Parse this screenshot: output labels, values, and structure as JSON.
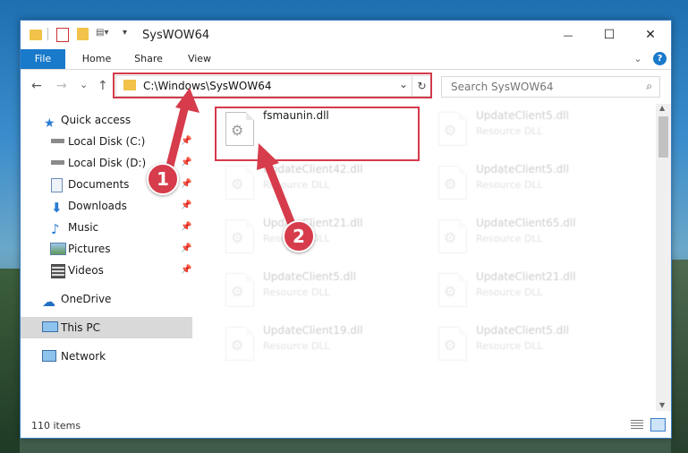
{
  "window": {
    "title": "SysWOW64",
    "minimize": "—",
    "maximize": "☐",
    "close": "✕"
  },
  "ribbon": {
    "tabs": [
      "File",
      "Home",
      "Share",
      "View"
    ],
    "expand": "⌄",
    "help": "?"
  },
  "nav": {
    "back": "←",
    "forward": "→",
    "recent": "⌄",
    "up": "↑"
  },
  "address": {
    "path": "C:\\Windows\\SysWOW64",
    "dropdown": "⌄",
    "refresh": "↻"
  },
  "search": {
    "placeholder": "Search SysWOW64",
    "icon": "search-icon"
  },
  "sidebar": {
    "items": [
      {
        "label": "Quick access",
        "icon": "star-icon"
      },
      {
        "label": "Local Disk (C:)",
        "icon": "drive-icon",
        "pinned": true
      },
      {
        "label": "Local Disk (D:)",
        "icon": "drive-icon",
        "pinned": true
      },
      {
        "label": "Documents",
        "icon": "documents-icon",
        "pinned": true
      },
      {
        "label": "Downloads",
        "icon": "download-icon",
        "pinned": true
      },
      {
        "label": "Music",
        "icon": "music-icon",
        "pinned": true
      },
      {
        "label": "Pictures",
        "icon": "pictures-icon",
        "pinned": true
      },
      {
        "label": "Videos",
        "icon": "videos-icon",
        "pinned": true
      },
      {
        "label": "OneDrive",
        "icon": "cloud-icon"
      },
      {
        "label": "This PC",
        "icon": "computer-icon",
        "selected": true
      },
      {
        "label": "Network",
        "icon": "network-icon"
      }
    ]
  },
  "files": [
    {
      "name": "fsmaunin.dll",
      "type": "",
      "highlight": true
    },
    {
      "name": "UpdateClient5.dll",
      "type": "Resource DLL"
    },
    {
      "name": "UpdateClient42.dll",
      "type": "Resource DLL"
    },
    {
      "name": "UpdateClient5.dll",
      "type": "Resource DLL"
    },
    {
      "name": "UpdateClient21.dll",
      "type": "Resource DLL"
    },
    {
      "name": "UpdateClient65.dll",
      "type": "Resource DLL"
    },
    {
      "name": "UpdateClient5.dll",
      "type": "Resource DLL"
    },
    {
      "name": "UpdateClient21.dll",
      "type": "Resource DLL"
    },
    {
      "name": "UpdateClient19.dll",
      "type": "Resource DLL"
    },
    {
      "name": "UpdateClient5.dll",
      "type": "Resource DLL"
    }
  ],
  "status": {
    "count": "110 items"
  },
  "callouts": [
    "1",
    "2"
  ],
  "colors": {
    "accent": "#1979ca",
    "callout": "#d63c4b",
    "selected": "#d9d9d9"
  }
}
